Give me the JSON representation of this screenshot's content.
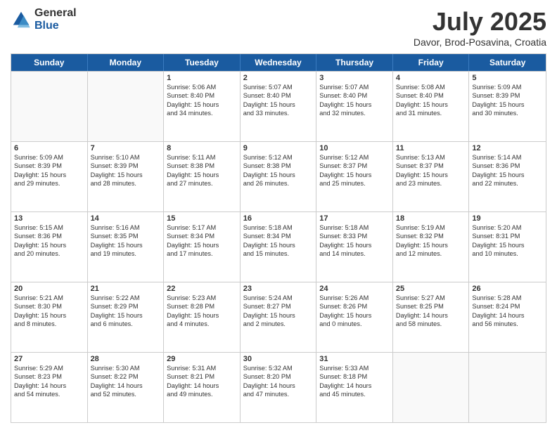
{
  "header": {
    "logo_general": "General",
    "logo_blue": "Blue",
    "title": "July 2025",
    "subtitle": "Davor, Brod-Posavina, Croatia"
  },
  "days_of_week": [
    "Sunday",
    "Monday",
    "Tuesday",
    "Wednesday",
    "Thursday",
    "Friday",
    "Saturday"
  ],
  "weeks": [
    [
      {
        "day": "",
        "lines": []
      },
      {
        "day": "",
        "lines": []
      },
      {
        "day": "1",
        "lines": [
          "Sunrise: 5:06 AM",
          "Sunset: 8:40 PM",
          "Daylight: 15 hours",
          "and 34 minutes."
        ]
      },
      {
        "day": "2",
        "lines": [
          "Sunrise: 5:07 AM",
          "Sunset: 8:40 PM",
          "Daylight: 15 hours",
          "and 33 minutes."
        ]
      },
      {
        "day": "3",
        "lines": [
          "Sunrise: 5:07 AM",
          "Sunset: 8:40 PM",
          "Daylight: 15 hours",
          "and 32 minutes."
        ]
      },
      {
        "day": "4",
        "lines": [
          "Sunrise: 5:08 AM",
          "Sunset: 8:40 PM",
          "Daylight: 15 hours",
          "and 31 minutes."
        ]
      },
      {
        "day": "5",
        "lines": [
          "Sunrise: 5:09 AM",
          "Sunset: 8:39 PM",
          "Daylight: 15 hours",
          "and 30 minutes."
        ]
      }
    ],
    [
      {
        "day": "6",
        "lines": [
          "Sunrise: 5:09 AM",
          "Sunset: 8:39 PM",
          "Daylight: 15 hours",
          "and 29 minutes."
        ]
      },
      {
        "day": "7",
        "lines": [
          "Sunrise: 5:10 AM",
          "Sunset: 8:39 PM",
          "Daylight: 15 hours",
          "and 28 minutes."
        ]
      },
      {
        "day": "8",
        "lines": [
          "Sunrise: 5:11 AM",
          "Sunset: 8:38 PM",
          "Daylight: 15 hours",
          "and 27 minutes."
        ]
      },
      {
        "day": "9",
        "lines": [
          "Sunrise: 5:12 AM",
          "Sunset: 8:38 PM",
          "Daylight: 15 hours",
          "and 26 minutes."
        ]
      },
      {
        "day": "10",
        "lines": [
          "Sunrise: 5:12 AM",
          "Sunset: 8:37 PM",
          "Daylight: 15 hours",
          "and 25 minutes."
        ]
      },
      {
        "day": "11",
        "lines": [
          "Sunrise: 5:13 AM",
          "Sunset: 8:37 PM",
          "Daylight: 15 hours",
          "and 23 minutes."
        ]
      },
      {
        "day": "12",
        "lines": [
          "Sunrise: 5:14 AM",
          "Sunset: 8:36 PM",
          "Daylight: 15 hours",
          "and 22 minutes."
        ]
      }
    ],
    [
      {
        "day": "13",
        "lines": [
          "Sunrise: 5:15 AM",
          "Sunset: 8:36 PM",
          "Daylight: 15 hours",
          "and 20 minutes."
        ]
      },
      {
        "day": "14",
        "lines": [
          "Sunrise: 5:16 AM",
          "Sunset: 8:35 PM",
          "Daylight: 15 hours",
          "and 19 minutes."
        ]
      },
      {
        "day": "15",
        "lines": [
          "Sunrise: 5:17 AM",
          "Sunset: 8:34 PM",
          "Daylight: 15 hours",
          "and 17 minutes."
        ]
      },
      {
        "day": "16",
        "lines": [
          "Sunrise: 5:18 AM",
          "Sunset: 8:34 PM",
          "Daylight: 15 hours",
          "and 15 minutes."
        ]
      },
      {
        "day": "17",
        "lines": [
          "Sunrise: 5:18 AM",
          "Sunset: 8:33 PM",
          "Daylight: 15 hours",
          "and 14 minutes."
        ]
      },
      {
        "day": "18",
        "lines": [
          "Sunrise: 5:19 AM",
          "Sunset: 8:32 PM",
          "Daylight: 15 hours",
          "and 12 minutes."
        ]
      },
      {
        "day": "19",
        "lines": [
          "Sunrise: 5:20 AM",
          "Sunset: 8:31 PM",
          "Daylight: 15 hours",
          "and 10 minutes."
        ]
      }
    ],
    [
      {
        "day": "20",
        "lines": [
          "Sunrise: 5:21 AM",
          "Sunset: 8:30 PM",
          "Daylight: 15 hours",
          "and 8 minutes."
        ]
      },
      {
        "day": "21",
        "lines": [
          "Sunrise: 5:22 AM",
          "Sunset: 8:29 PM",
          "Daylight: 15 hours",
          "and 6 minutes."
        ]
      },
      {
        "day": "22",
        "lines": [
          "Sunrise: 5:23 AM",
          "Sunset: 8:28 PM",
          "Daylight: 15 hours",
          "and 4 minutes."
        ]
      },
      {
        "day": "23",
        "lines": [
          "Sunrise: 5:24 AM",
          "Sunset: 8:27 PM",
          "Daylight: 15 hours",
          "and 2 minutes."
        ]
      },
      {
        "day": "24",
        "lines": [
          "Sunrise: 5:26 AM",
          "Sunset: 8:26 PM",
          "Daylight: 15 hours",
          "and 0 minutes."
        ]
      },
      {
        "day": "25",
        "lines": [
          "Sunrise: 5:27 AM",
          "Sunset: 8:25 PM",
          "Daylight: 14 hours",
          "and 58 minutes."
        ]
      },
      {
        "day": "26",
        "lines": [
          "Sunrise: 5:28 AM",
          "Sunset: 8:24 PM",
          "Daylight: 14 hours",
          "and 56 minutes."
        ]
      }
    ],
    [
      {
        "day": "27",
        "lines": [
          "Sunrise: 5:29 AM",
          "Sunset: 8:23 PM",
          "Daylight: 14 hours",
          "and 54 minutes."
        ]
      },
      {
        "day": "28",
        "lines": [
          "Sunrise: 5:30 AM",
          "Sunset: 8:22 PM",
          "Daylight: 14 hours",
          "and 52 minutes."
        ]
      },
      {
        "day": "29",
        "lines": [
          "Sunrise: 5:31 AM",
          "Sunset: 8:21 PM",
          "Daylight: 14 hours",
          "and 49 minutes."
        ]
      },
      {
        "day": "30",
        "lines": [
          "Sunrise: 5:32 AM",
          "Sunset: 8:20 PM",
          "Daylight: 14 hours",
          "and 47 minutes."
        ]
      },
      {
        "day": "31",
        "lines": [
          "Sunrise: 5:33 AM",
          "Sunset: 8:18 PM",
          "Daylight: 14 hours",
          "and 45 minutes."
        ]
      },
      {
        "day": "",
        "lines": []
      },
      {
        "day": "",
        "lines": []
      }
    ]
  ]
}
